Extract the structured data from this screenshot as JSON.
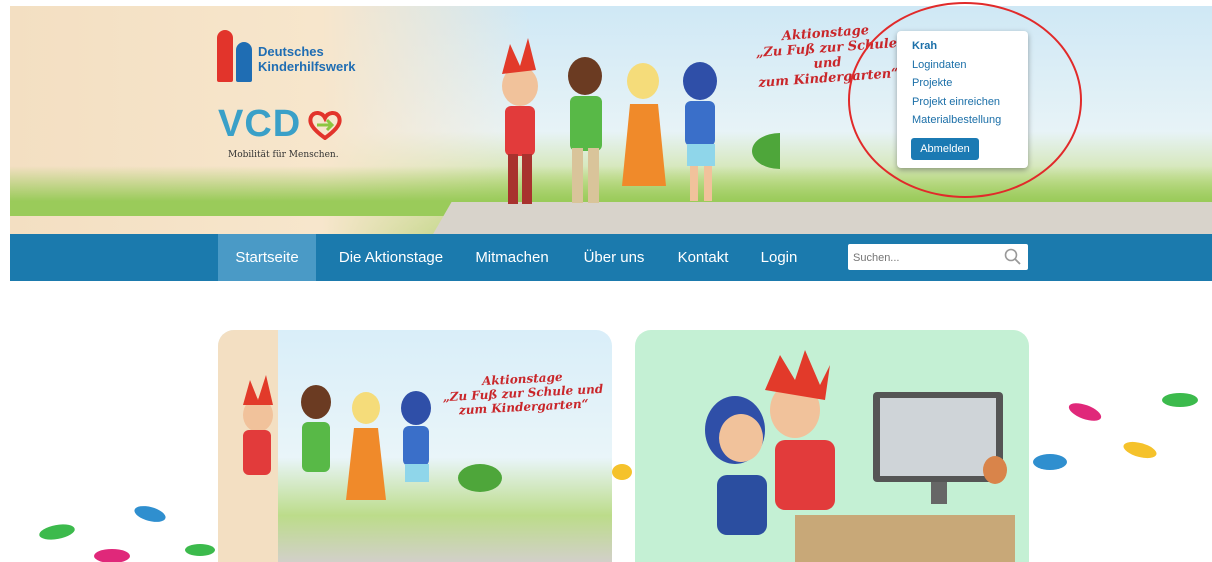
{
  "header": {
    "dkhw_line1": "Deutsches",
    "dkhw_line2": "Kinderhilfswerk",
    "vcd_logo": "VCD",
    "vcd_tagline": "Mobilität für Menschen.",
    "event_title_line1": "Aktionstage",
    "event_title_line2": "„Zu Fuß zur Schule und",
    "event_title_line3": "zum Kindergarten“"
  },
  "user_menu": {
    "username": "Krah",
    "items": [
      "Logindaten",
      "Projekte",
      "Projekt einreichen",
      "Materialbestellung"
    ],
    "logout_label": "Abmelden"
  },
  "nav": {
    "items": [
      "Startseite",
      "Die Aktionstage",
      "Mitmachen",
      "Über uns",
      "Kontakt",
      "Login"
    ],
    "active_index": 0,
    "search_placeholder": "Suchen..."
  },
  "cards": {
    "card1_title_line1": "Aktionstage",
    "card1_title_line2": "„Zu Fuß zur Schule und",
    "card1_title_line3": "zum Kindergarten“"
  },
  "colors": {
    "nav_bg": "#1b7aad",
    "nav_active": "#4a9ac6",
    "highlight_circle": "#e12a2a",
    "link": "#1b6fa8"
  }
}
